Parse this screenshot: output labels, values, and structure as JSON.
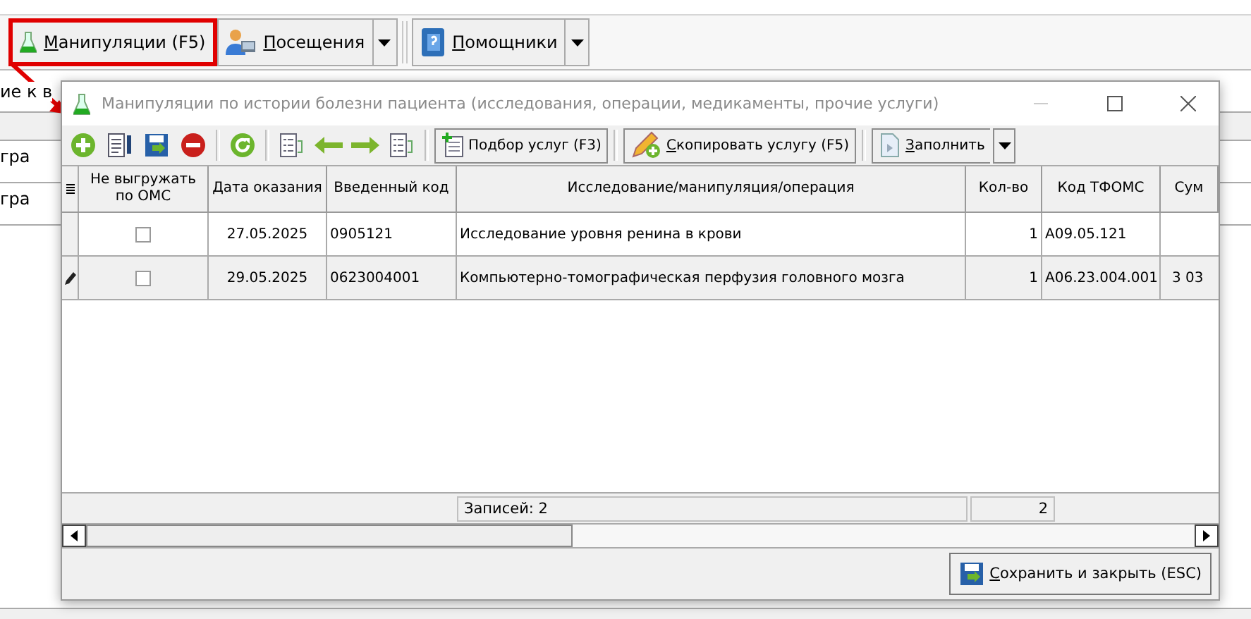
{
  "main_toolbar": {
    "buttons": [
      {
        "label": "Манипуляции (F5)",
        "highlighted": true,
        "dropdown": false
      },
      {
        "label": "Посещения",
        "highlighted": false,
        "dropdown": true
      },
      {
        "label": "Помощники",
        "highlighted": false,
        "dropdown": true
      }
    ]
  },
  "background": {
    "label": "ие к в",
    "rows": [
      "гра",
      "гра"
    ]
  },
  "dialog": {
    "title": "Манипуляции по истории болезни пациента (исследования, операции, медикаменты, прочие услуги)",
    "toolbar": {
      "buttons": [
        {
          "label": "Подбор услуг (F3)",
          "dropdown": false
        },
        {
          "label": "Скопировать услугу (F5)",
          "dropdown": false
        },
        {
          "label": "Заполнить",
          "dropdown": true
        }
      ]
    },
    "table": {
      "columns": [
        "Не выгружать по ОМС",
        "Дата оказания",
        "Введенный код",
        "Исследование/манипуляция/операция",
        "Кол-во",
        "Код ТФОМС",
        "Сум"
      ],
      "rows": [
        {
          "editing": false,
          "checked": false,
          "date": "27.05.2025",
          "code": "0905121",
          "service": "Исследование уровня ренина в крови",
          "qty": "1",
          "tfoms": "A09.05.121"
        },
        {
          "editing": true,
          "checked": false,
          "date": "29.05.2025",
          "code": "0623004001",
          "service": "Компьютерно-томографическая перфузия головного мозга",
          "qty": "1",
          "tfoms": "A06.23.004.001",
          "sum": "3 03"
        }
      ]
    },
    "footer": {
      "records": "Записей: 2",
      "total": "2"
    },
    "save_button": "Сохранить и закрыть (ESC)"
  }
}
